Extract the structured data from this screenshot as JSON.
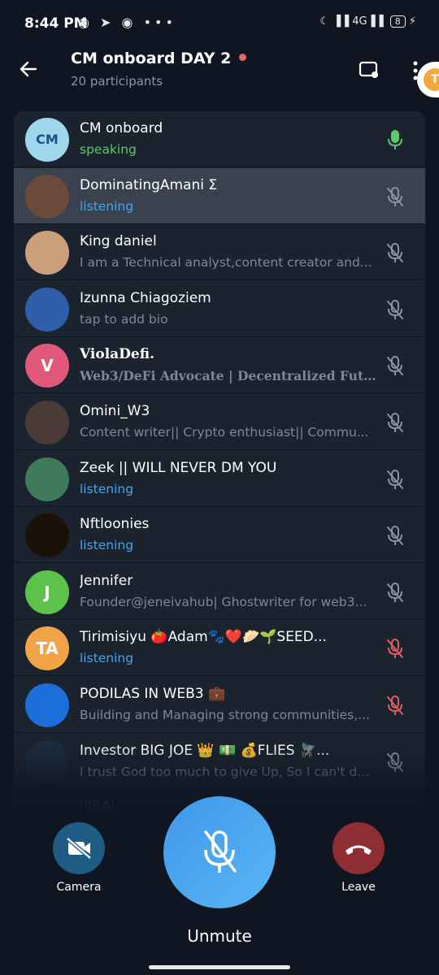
{
  "status_bar": {
    "time": "8:44 PM",
    "left_icons": "◉ ➤ ◉ •••",
    "right_icons": "☾ ▐▐ 4G▐▐",
    "battery": "8"
  },
  "header": {
    "title": "CM onboard DAY 2",
    "subtitle": "20 participants",
    "floating_badge": "T"
  },
  "participants": [
    {
      "name": "CM onboard",
      "status": "speaking",
      "status_type": "speaking",
      "avatar_initials": "CM",
      "avatar_color": "#9fd6ea",
      "mic": "active"
    },
    {
      "name": "DominatingAmani Σ",
      "status": "listening",
      "status_type": "listening",
      "avatar_initials": "",
      "avatar_color": "#6b4a3a",
      "mic": "muted"
    },
    {
      "name": "King daniel",
      "status": "I am a Technical analyst,content creator and...",
      "status_type": "bio",
      "avatar_initials": "",
      "avatar_color": "#c9a07a",
      "mic": "muted"
    },
    {
      "name": "Izunna Chiagoziem",
      "status": "tap to add bio",
      "status_type": "bio",
      "avatar_initials": "",
      "avatar_color": "#2e5fa8",
      "mic": "muted"
    },
    {
      "name": "ViolaDefi.",
      "status": "Web3/DeFi Advocate | Decentralized Future...",
      "status_type": "bio",
      "avatar_initials": "V",
      "avatar_color": "#e0587a",
      "mic": "muted"
    },
    {
      "name": "Omini_W3",
      "status": "Content writer|| Crypto enthusiast|| Commu...",
      "status_type": "bio",
      "avatar_initials": "",
      "avatar_color": "#4a3a38",
      "mic": "muted"
    },
    {
      "name": "Zeek || WILL NEVER DM YOU",
      "status": "listening",
      "status_type": "listening",
      "avatar_initials": "",
      "avatar_color": "#3f7a5a",
      "mic": "muted"
    },
    {
      "name": "Nftloonies",
      "status": "listening",
      "status_type": "listening",
      "avatar_initials": "",
      "avatar_color": "#1a1208",
      "mic": "muted"
    },
    {
      "name": "Jennifer",
      "status": "Founder@jeneivahub| Ghostwriter for web3...",
      "status_type": "bio",
      "avatar_initials": "J",
      "avatar_color": "#5cc24a",
      "mic": "muted"
    },
    {
      "name": "Tirimisiyu 🍅Adam🐾❤️🥟🌱SEED...",
      "status": "listening",
      "status_type": "listening",
      "avatar_initials": "TA",
      "avatar_color": "#f0a347",
      "mic": "muted-red"
    },
    {
      "name": "PODILAS IN WEB3 💼",
      "status": "Building and Managing strong communities,...",
      "status_type": "bio",
      "avatar_initials": "",
      "avatar_color": "#1c6fd8",
      "mic": "muted-red"
    },
    {
      "name": "Investor BIG JOE 👑 💵 💰FLIES 🪰...",
      "status": "I trust God too much to give Up, So I can't d...",
      "status_type": "bio",
      "avatar_initials": "",
      "avatar_color": "#1d2a3a",
      "mic": "muted"
    },
    {
      "name": "IIIBAL",
      "status": "",
      "status_type": "bio",
      "avatar_initials": "",
      "avatar_color": "#2a3340",
      "mic": "muted"
    }
  ],
  "controls": {
    "camera_label": "Camera",
    "leave_label": "Leave",
    "unmute_label": "Unmute"
  },
  "colors": {
    "speaking": "#5ec76d",
    "listening": "#4da3e0",
    "muted_red": "#e25c60",
    "muted_gray": "#8a93a0"
  }
}
